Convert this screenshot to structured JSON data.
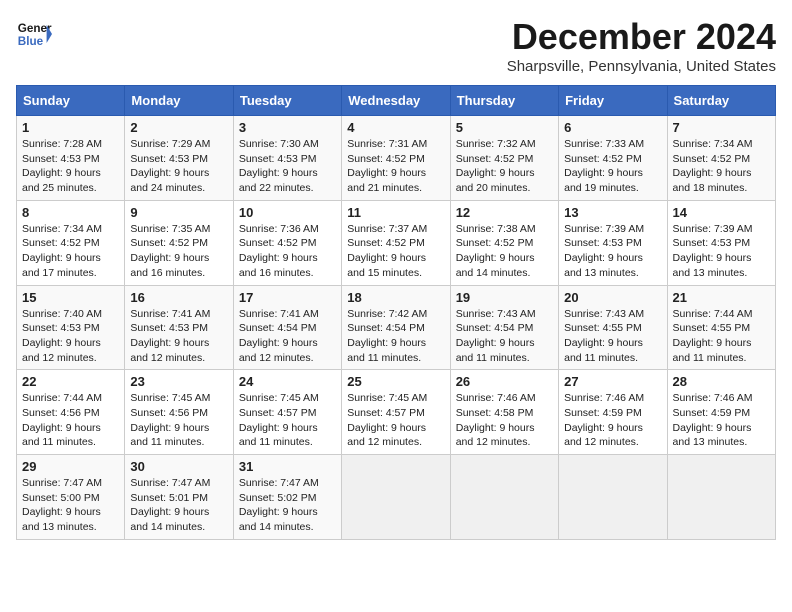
{
  "header": {
    "logo_line1": "General",
    "logo_line2": "Blue",
    "month": "December 2024",
    "location": "Sharpsville, Pennsylvania, United States"
  },
  "days_of_week": [
    "Sunday",
    "Monday",
    "Tuesday",
    "Wednesday",
    "Thursday",
    "Friday",
    "Saturday"
  ],
  "weeks": [
    [
      {
        "day": 1,
        "sunrise": "7:28 AM",
        "sunset": "4:53 PM",
        "daylight": "9 hours and 25 minutes."
      },
      {
        "day": 2,
        "sunrise": "7:29 AM",
        "sunset": "4:53 PM",
        "daylight": "9 hours and 24 minutes."
      },
      {
        "day": 3,
        "sunrise": "7:30 AM",
        "sunset": "4:53 PM",
        "daylight": "9 hours and 22 minutes."
      },
      {
        "day": 4,
        "sunrise": "7:31 AM",
        "sunset": "4:52 PM",
        "daylight": "9 hours and 21 minutes."
      },
      {
        "day": 5,
        "sunrise": "7:32 AM",
        "sunset": "4:52 PM",
        "daylight": "9 hours and 20 minutes."
      },
      {
        "day": 6,
        "sunrise": "7:33 AM",
        "sunset": "4:52 PM",
        "daylight": "9 hours and 19 minutes."
      },
      {
        "day": 7,
        "sunrise": "7:34 AM",
        "sunset": "4:52 PM",
        "daylight": "9 hours and 18 minutes."
      }
    ],
    [
      {
        "day": 8,
        "sunrise": "7:34 AM",
        "sunset": "4:52 PM",
        "daylight": "9 hours and 17 minutes."
      },
      {
        "day": 9,
        "sunrise": "7:35 AM",
        "sunset": "4:52 PM",
        "daylight": "9 hours and 16 minutes."
      },
      {
        "day": 10,
        "sunrise": "7:36 AM",
        "sunset": "4:52 PM",
        "daylight": "9 hours and 16 minutes."
      },
      {
        "day": 11,
        "sunrise": "7:37 AM",
        "sunset": "4:52 PM",
        "daylight": "9 hours and 15 minutes."
      },
      {
        "day": 12,
        "sunrise": "7:38 AM",
        "sunset": "4:52 PM",
        "daylight": "9 hours and 14 minutes."
      },
      {
        "day": 13,
        "sunrise": "7:39 AM",
        "sunset": "4:53 PM",
        "daylight": "9 hours and 13 minutes."
      },
      {
        "day": 14,
        "sunrise": "7:39 AM",
        "sunset": "4:53 PM",
        "daylight": "9 hours and 13 minutes."
      }
    ],
    [
      {
        "day": 15,
        "sunrise": "7:40 AM",
        "sunset": "4:53 PM",
        "daylight": "9 hours and 12 minutes."
      },
      {
        "day": 16,
        "sunrise": "7:41 AM",
        "sunset": "4:53 PM",
        "daylight": "9 hours and 12 minutes."
      },
      {
        "day": 17,
        "sunrise": "7:41 AM",
        "sunset": "4:54 PM",
        "daylight": "9 hours and 12 minutes."
      },
      {
        "day": 18,
        "sunrise": "7:42 AM",
        "sunset": "4:54 PM",
        "daylight": "9 hours and 11 minutes."
      },
      {
        "day": 19,
        "sunrise": "7:43 AM",
        "sunset": "4:54 PM",
        "daylight": "9 hours and 11 minutes."
      },
      {
        "day": 20,
        "sunrise": "7:43 AM",
        "sunset": "4:55 PM",
        "daylight": "9 hours and 11 minutes."
      },
      {
        "day": 21,
        "sunrise": "7:44 AM",
        "sunset": "4:55 PM",
        "daylight": "9 hours and 11 minutes."
      }
    ],
    [
      {
        "day": 22,
        "sunrise": "7:44 AM",
        "sunset": "4:56 PM",
        "daylight": "9 hours and 11 minutes."
      },
      {
        "day": 23,
        "sunrise": "7:45 AM",
        "sunset": "4:56 PM",
        "daylight": "9 hours and 11 minutes."
      },
      {
        "day": 24,
        "sunrise": "7:45 AM",
        "sunset": "4:57 PM",
        "daylight": "9 hours and 11 minutes."
      },
      {
        "day": 25,
        "sunrise": "7:45 AM",
        "sunset": "4:57 PM",
        "daylight": "9 hours and 12 minutes."
      },
      {
        "day": 26,
        "sunrise": "7:46 AM",
        "sunset": "4:58 PM",
        "daylight": "9 hours and 12 minutes."
      },
      {
        "day": 27,
        "sunrise": "7:46 AM",
        "sunset": "4:59 PM",
        "daylight": "9 hours and 12 minutes."
      },
      {
        "day": 28,
        "sunrise": "7:46 AM",
        "sunset": "4:59 PM",
        "daylight": "9 hours and 13 minutes."
      }
    ],
    [
      {
        "day": 29,
        "sunrise": "7:47 AM",
        "sunset": "5:00 PM",
        "daylight": "9 hours and 13 minutes."
      },
      {
        "day": 30,
        "sunrise": "7:47 AM",
        "sunset": "5:01 PM",
        "daylight": "9 hours and 14 minutes."
      },
      {
        "day": 31,
        "sunrise": "7:47 AM",
        "sunset": "5:02 PM",
        "daylight": "9 hours and 14 minutes."
      },
      null,
      null,
      null,
      null
    ]
  ]
}
